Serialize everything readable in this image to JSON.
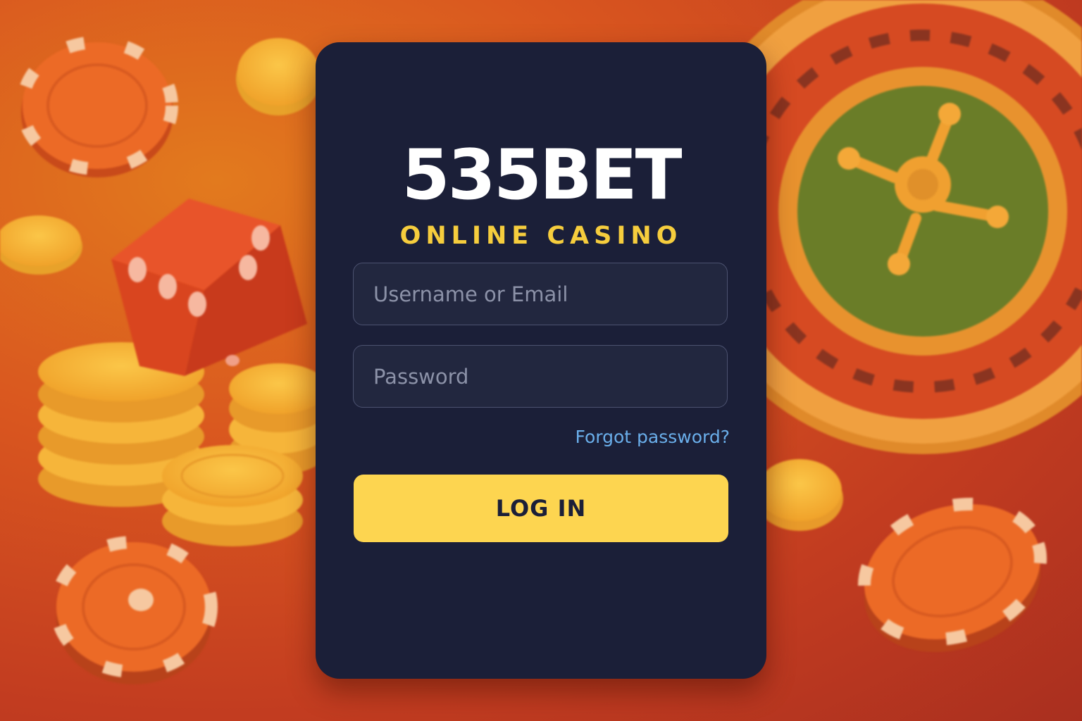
{
  "brand": {
    "name": "535BET",
    "tagline": "ONLINE CASINO"
  },
  "form": {
    "username_placeholder": "Username or Email",
    "password_placeholder": "Password",
    "forgot_label": "Forgot password?",
    "login_label": "LOG IN"
  },
  "theme": {
    "card_bg": "#1b1f38",
    "accent_yellow": "#fdd550",
    "link_blue": "#6aaeea",
    "background_red": "#c23c20"
  },
  "decor": [
    "casino-chip-icon",
    "gold-coin-icon",
    "dice-icon",
    "roulette-wheel-icon"
  ]
}
